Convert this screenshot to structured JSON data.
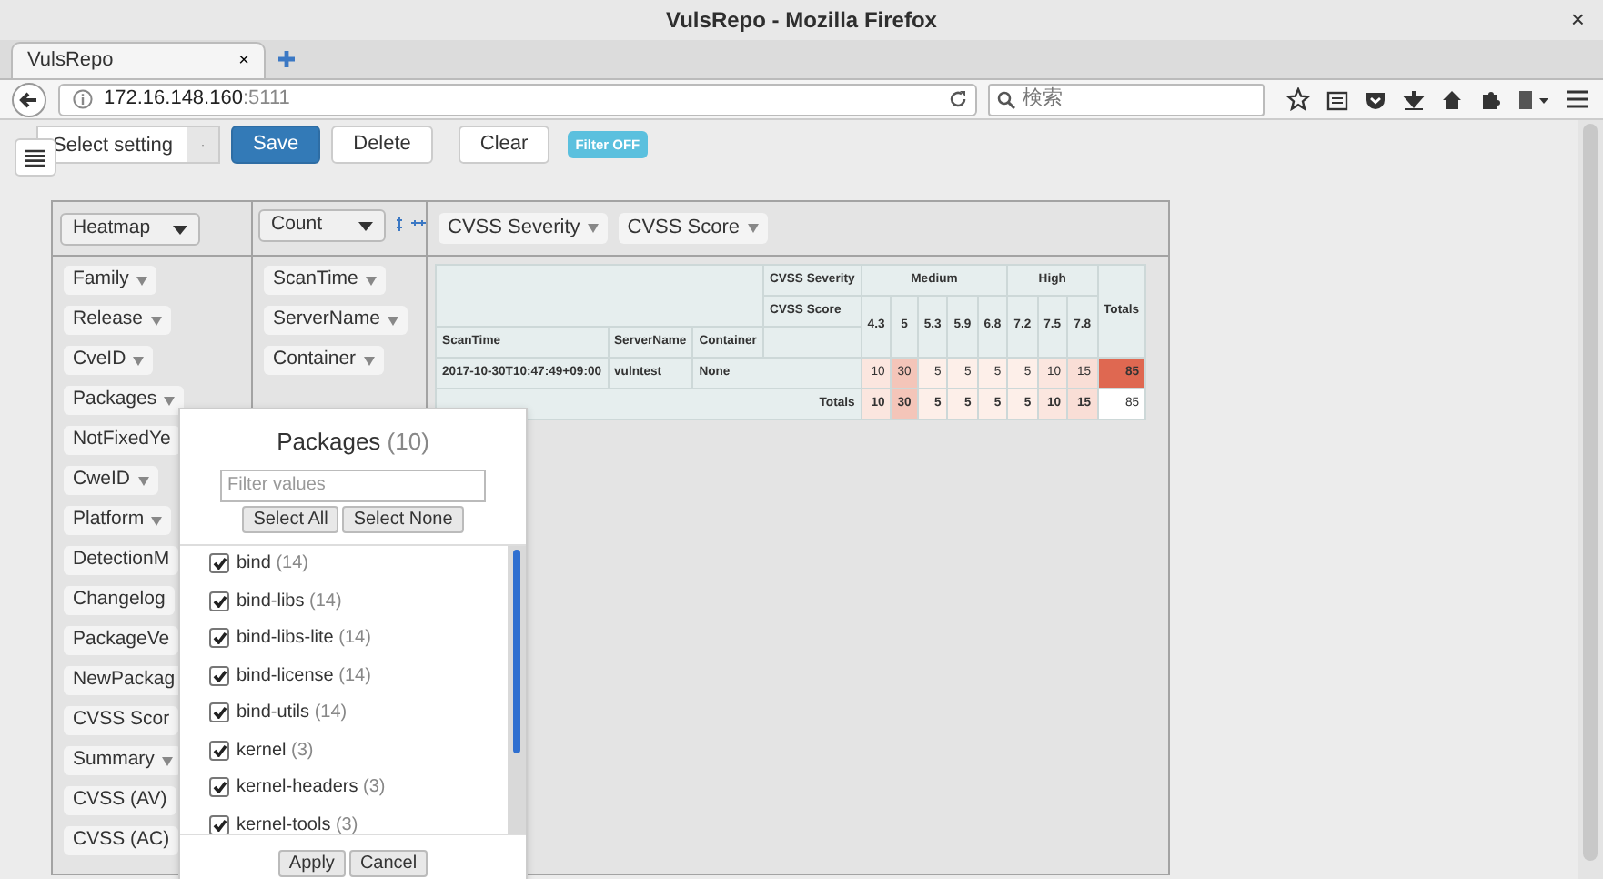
{
  "window": {
    "title": "VulsRepo - Mozilla Firefox",
    "close_glyph": "×"
  },
  "tabs": [
    {
      "label": "VulsRepo",
      "selected": true,
      "close_glyph": "×"
    }
  ],
  "address_bar": {
    "host": "172.16.148.160",
    "port": ":5111"
  },
  "search": {
    "placeholder": "検索"
  },
  "toolbar": {
    "setting_select": "Select setting",
    "buttons": [
      {
        "label": "Save",
        "kind": "primary"
      },
      {
        "label": "Delete",
        "kind": "default"
      },
      {
        "label": "Clear",
        "kind": "default"
      }
    ],
    "filter_badge": "Filter OFF"
  },
  "pivot": {
    "renderer": "Heatmap",
    "aggregator": "Count",
    "column_attrs": [
      "CVSS Severity",
      "CVSS Score"
    ],
    "row_attrs": [
      "ScanTime",
      "ServerName",
      "Container"
    ],
    "unused_attrs": [
      {
        "label": "Family",
        "show_caret": true
      },
      {
        "label": "Release",
        "show_caret": true
      },
      {
        "label": "CveID",
        "show_caret": true
      },
      {
        "label": "Packages",
        "show_caret": true
      },
      {
        "label": "NotFixedYe",
        "show_caret": false
      },
      {
        "label": "CweID",
        "show_caret": true
      },
      {
        "label": "Platform",
        "show_caret": true
      },
      {
        "label": "DetectionM",
        "show_caret": false
      },
      {
        "label": "Changelog",
        "show_caret": false
      },
      {
        "label": "PackageVe",
        "show_caret": false
      },
      {
        "label": "NewPackag",
        "show_caret": false
      },
      {
        "label": "CVSS Scor",
        "show_caret": false
      },
      {
        "label": "Summary",
        "show_caret": true
      },
      {
        "label": "CVSS (AV)",
        "show_caret": false
      },
      {
        "label": "CVSS (AC)",
        "show_caret": false
      }
    ]
  },
  "table": {
    "severity_label": "CVSS Severity",
    "score_label": "CVSS Score",
    "totals_header": "Totals",
    "severity_groups": [
      {
        "label": "Medium",
        "scores": [
          "4.3",
          "5",
          "5.3",
          "5.9",
          "6.8"
        ]
      },
      {
        "label": "High",
        "scores": [
          "7.2",
          "7.5",
          "7.8"
        ]
      }
    ],
    "row_headers": [
      "ScanTime",
      "ServerName",
      "Container"
    ],
    "rows": [
      {
        "labels": [
          "2017-10-30T10:47:49+09:00",
          "vulntest",
          "None"
        ],
        "values": [
          "10",
          "30",
          "5",
          "5",
          "5",
          "5",
          "10",
          "15"
        ],
        "total": "85"
      }
    ],
    "totals_row": {
      "label": "Totals",
      "values": [
        "10",
        "30",
        "5",
        "5",
        "5",
        "5",
        "10",
        "15"
      ],
      "total": "85"
    }
  },
  "filter_popup": {
    "title": "Packages",
    "count": "(10)",
    "placeholder": "Filter values",
    "buttons": [
      "Select All",
      "Select None"
    ],
    "items": [
      {
        "name": "bind",
        "count": "(14)",
        "checked": true
      },
      {
        "name": "bind-libs",
        "count": "(14)",
        "checked": true
      },
      {
        "name": "bind-libs-lite",
        "count": "(14)",
        "checked": true
      },
      {
        "name": "bind-license",
        "count": "(14)",
        "checked": true
      },
      {
        "name": "bind-utils",
        "count": "(14)",
        "checked": true
      },
      {
        "name": "kernel",
        "count": "(3)",
        "checked": true
      },
      {
        "name": "kernel-headers",
        "count": "(3)",
        "checked": true
      },
      {
        "name": "kernel-tools",
        "count": "(3)",
        "checked": true
      }
    ],
    "footer_buttons": [
      "Apply",
      "Cancel"
    ]
  }
}
